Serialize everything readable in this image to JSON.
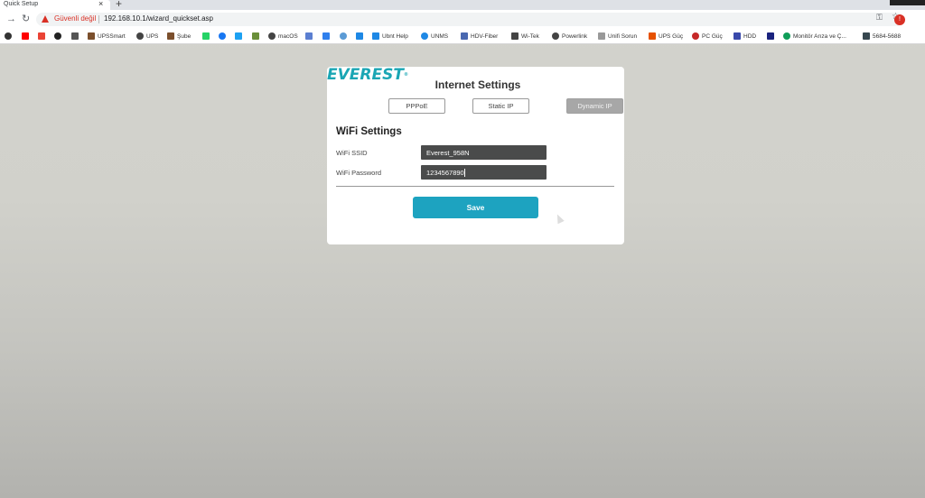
{
  "browser": {
    "tab_title": "Quick Setup",
    "close_glyph": "×",
    "new_tab_glyph": "+",
    "back_glyph": "→",
    "reload_glyph": "↻",
    "not_secure_label": "Güvenli değil",
    "url": "192.168.10.1/wizard_quickset.asp",
    "key_glyph": "⚿",
    "star_glyph": "☆",
    "profile_glyph": "!"
  },
  "bookmarks": [
    {
      "label": "",
      "color": "#333333"
    },
    {
      "label": "",
      "color": "#ff0000"
    },
    {
      "label": "",
      "color": "#ea4335"
    },
    {
      "label": "",
      "color": "#222222"
    },
    {
      "label": "",
      "color": "#555555"
    },
    {
      "label": "UPSSmart",
      "color": "#7b4f2c"
    },
    {
      "label": "UPS",
      "color": "#444444"
    },
    {
      "label": "Şube",
      "color": "#7b4f2c"
    },
    {
      "label": "",
      "color": "#25d366"
    },
    {
      "label": "",
      "color": "#1877f2"
    },
    {
      "label": "",
      "color": "#1da1f2"
    },
    {
      "label": "",
      "color": "#6a8f3a"
    },
    {
      "label": "macOS",
      "color": "#444444"
    },
    {
      "label": "",
      "color": "#5b7fd1"
    },
    {
      "label": "",
      "color": "#2f80ed"
    },
    {
      "label": "",
      "color": "#5b9bd5"
    },
    {
      "label": "",
      "color": "#1e88e5"
    },
    {
      "label": "Ubnt Help",
      "color": "#1e88e5"
    },
    {
      "label": "UNMS",
      "color": "#1e88e5"
    },
    {
      "label": "HDV-Fiber",
      "color": "#4a68b0"
    },
    {
      "label": "Wi-Tek",
      "color": "#444444"
    },
    {
      "label": "Powerlink",
      "color": "#444444"
    },
    {
      "label": "Unifi Sorun",
      "color": "#999999"
    },
    {
      "label": "UPS Güç",
      "color": "#e65100"
    },
    {
      "label": "PC Güç",
      "color": "#c62828"
    },
    {
      "label": "HDD",
      "color": "#3949ab"
    },
    {
      "label": "",
      "color": "#1a237e"
    },
    {
      "label": "Monitör Arıza ve Ç...",
      "color": "#0f9d58"
    },
    {
      "label": "5684-5688",
      "color": "#37474f"
    }
  ],
  "card": {
    "logo_text": "EVEREST",
    "logo_mark": "®",
    "title": "Internet Settings",
    "tabs": [
      {
        "label": "PPPoE",
        "active": false
      },
      {
        "label": "Static IP",
        "active": false
      },
      {
        "label": "Dynamic IP",
        "active": true
      }
    ],
    "section_title": "WiFi Settings",
    "ssid_label": "WiFi SSID",
    "ssid_value": "Everest_958N",
    "password_label": "WiFi Password",
    "password_value": "1234567890",
    "save_label": "Save"
  },
  "colors": {
    "accent": "#1da3c0",
    "logo": "#1aa6b4",
    "input_bg": "#4a4b4b"
  }
}
